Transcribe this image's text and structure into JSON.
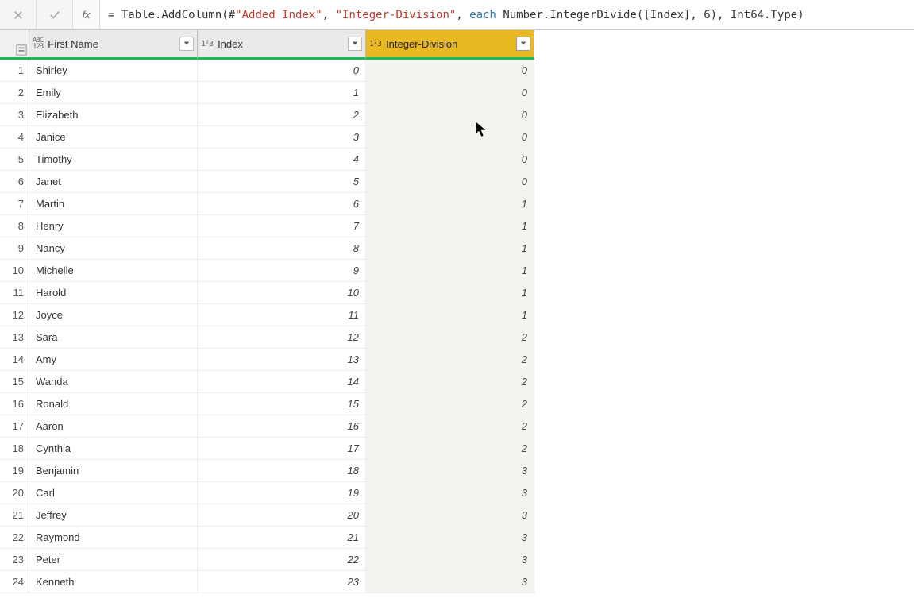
{
  "formula": {
    "eq": "= ",
    "fn1": "Table.AddColumn(#",
    "str1": "\"Added Index\"",
    "comma1": ", ",
    "str2": "\"Integer-Division\"",
    "comma2": ", ",
    "kw1": "each",
    "fn2": " Number.IntegerDivide([Index], ",
    "num1": "6",
    "fn3": "), Int64.Type)"
  },
  "fx": "fx",
  "columns": {
    "firstName": {
      "label": "First Name",
      "typeIcon": "ABC\n123"
    },
    "index": {
      "label": "Index",
      "typeIcon": "1²3"
    },
    "integerDivision": {
      "label": "Integer-Division",
      "typeIcon": "1²3"
    }
  },
  "rows": [
    {
      "n": "1",
      "firstName": "Shirley",
      "index": "0",
      "intDiv": "0"
    },
    {
      "n": "2",
      "firstName": "Emily",
      "index": "1",
      "intDiv": "0"
    },
    {
      "n": "3",
      "firstName": "Elizabeth",
      "index": "2",
      "intDiv": "0"
    },
    {
      "n": "4",
      "firstName": "Janice",
      "index": "3",
      "intDiv": "0"
    },
    {
      "n": "5",
      "firstName": "Timothy",
      "index": "4",
      "intDiv": "0"
    },
    {
      "n": "6",
      "firstName": "Janet",
      "index": "5",
      "intDiv": "0"
    },
    {
      "n": "7",
      "firstName": "Martin",
      "index": "6",
      "intDiv": "1"
    },
    {
      "n": "8",
      "firstName": "Henry",
      "index": "7",
      "intDiv": "1"
    },
    {
      "n": "9",
      "firstName": "Nancy",
      "index": "8",
      "intDiv": "1"
    },
    {
      "n": "10",
      "firstName": "Michelle",
      "index": "9",
      "intDiv": "1"
    },
    {
      "n": "11",
      "firstName": "Harold",
      "index": "10",
      "intDiv": "1"
    },
    {
      "n": "12",
      "firstName": "Joyce",
      "index": "11",
      "intDiv": "1"
    },
    {
      "n": "13",
      "firstName": "Sara",
      "index": "12",
      "intDiv": "2"
    },
    {
      "n": "14",
      "firstName": "Amy",
      "index": "13",
      "intDiv": "2"
    },
    {
      "n": "15",
      "firstName": "Wanda",
      "index": "14",
      "intDiv": "2"
    },
    {
      "n": "16",
      "firstName": "Ronald",
      "index": "15",
      "intDiv": "2"
    },
    {
      "n": "17",
      "firstName": "Aaron",
      "index": "16",
      "intDiv": "2"
    },
    {
      "n": "18",
      "firstName": "Cynthia",
      "index": "17",
      "intDiv": "2"
    },
    {
      "n": "19",
      "firstName": "Benjamin",
      "index": "18",
      "intDiv": "3"
    },
    {
      "n": "20",
      "firstName": "Carl",
      "index": "19",
      "intDiv": "3"
    },
    {
      "n": "21",
      "firstName": "Jeffrey",
      "index": "20",
      "intDiv": "3"
    },
    {
      "n": "22",
      "firstName": "Raymond",
      "index": "21",
      "intDiv": "3"
    },
    {
      "n": "23",
      "firstName": "Peter",
      "index": "22",
      "intDiv": "3"
    },
    {
      "n": "24",
      "firstName": "Kenneth",
      "index": "23",
      "intDiv": "3"
    }
  ]
}
